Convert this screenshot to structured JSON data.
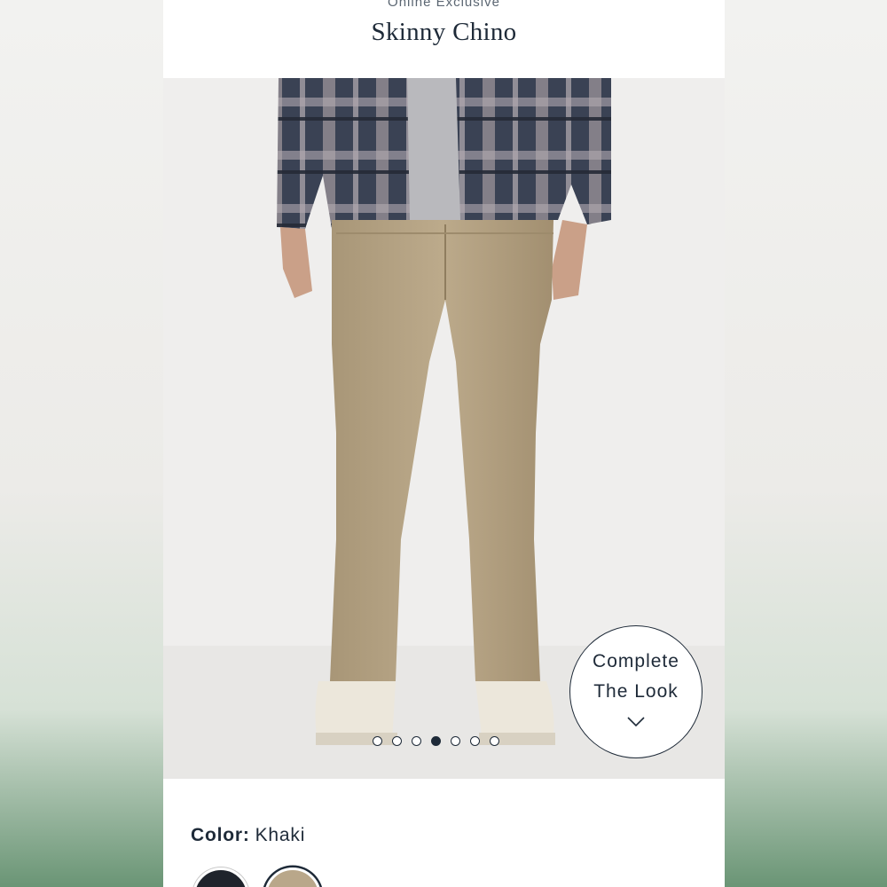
{
  "header": {
    "eyebrow": "Online Exclusive",
    "title": "Skinny Chino"
  },
  "gallery": {
    "image_alt": "Model wearing khaki skinny chino with plaid flannel shirt and white sneakers",
    "dot_count": 7,
    "active_dot_index": 3
  },
  "complete_the_look": {
    "line1": "Complete",
    "line2": "The Look",
    "icon": "chevron-down-icon"
  },
  "color": {
    "label": "Color:",
    "value": "Khaki",
    "swatches": [
      {
        "name": "navy",
        "hex": "#1f242c",
        "selected": false
      },
      {
        "name": "khaki",
        "hex": "#b9a78a",
        "selected": true
      }
    ]
  },
  "colors": {
    "text_primary": "#1e2a38",
    "eyebrow": "#5b6672",
    "page_bg": "#ffffff",
    "backdrop_green": "#6f9a7a"
  }
}
